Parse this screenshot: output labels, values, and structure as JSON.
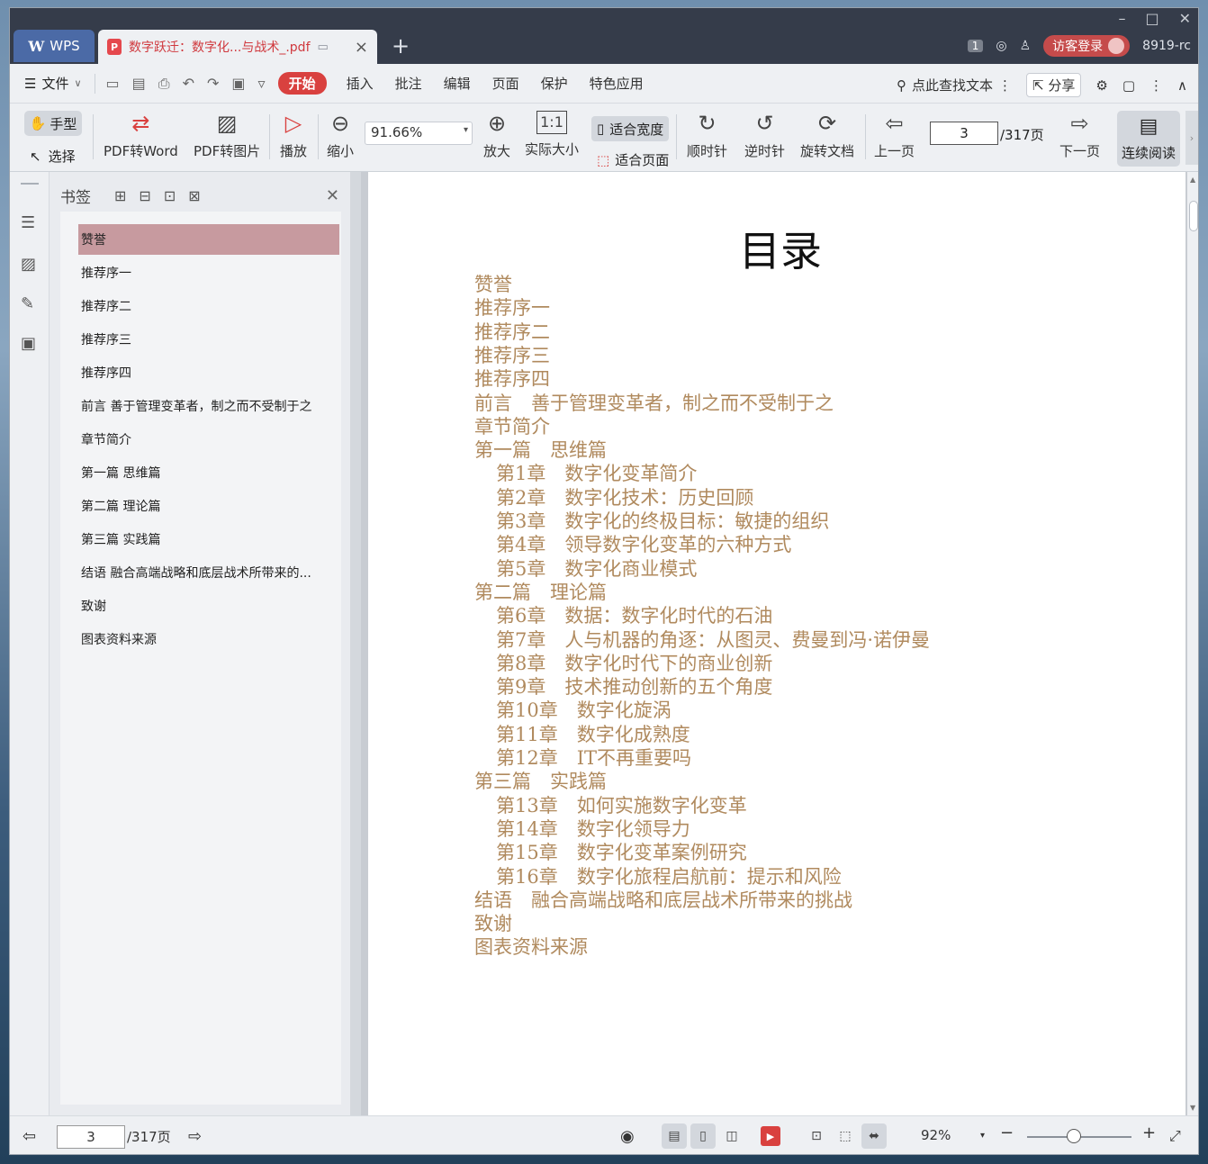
{
  "titlebar": {
    "wps_tab": "WPS",
    "doc_tab_title": "数字跃迁：数字化...与战术_.pdf",
    "page_badge": "1",
    "login_label": "访客登录",
    "user_id": "8919-rc"
  },
  "menu": {
    "file": "文件",
    "items": [
      "开始",
      "插入",
      "批注",
      "编辑",
      "页面",
      "保护",
      "特色应用"
    ],
    "search_label": "点此查找文本",
    "share_label": "分享"
  },
  "ribbon": {
    "hand": "手型",
    "select": "选择",
    "pdf_to_word": "PDF转Word",
    "pdf_to_image": "PDF转图片",
    "play": "播放",
    "zoom_out": "缩小",
    "zoom_value": "91.66%",
    "zoom_in": "放大",
    "actual_size": "实际大小",
    "fit_width": "适合宽度",
    "fit_page": "适合页面",
    "rotate_cw": "顺时针",
    "rotate_ccw": "逆时针",
    "rotate_doc": "旋转文档",
    "prev_page": "上一页",
    "current_page": "3",
    "total_pages": "/317页",
    "next_page": "下一页",
    "continuous": "连续阅读"
  },
  "bookmarks": {
    "title": "书签",
    "items": [
      {
        "label": "赞誉",
        "expandable": false,
        "selected": true
      },
      {
        "label": "推荐序一",
        "expandable": false
      },
      {
        "label": "推荐序二",
        "expandable": false
      },
      {
        "label": "推荐序三",
        "expandable": false
      },
      {
        "label": "推荐序四",
        "expandable": false
      },
      {
        "label": "前言 善于管理变革者，制之而不受制于之",
        "expandable": false
      },
      {
        "label": "章节简介",
        "expandable": false
      },
      {
        "label": "第一篇 思维篇",
        "expandable": true
      },
      {
        "label": "第二篇 理论篇",
        "expandable": true
      },
      {
        "label": "第三篇 实践篇",
        "expandable": true
      },
      {
        "label": "结语 融合高端战略和底层战术所带来的...",
        "expandable": false
      },
      {
        "label": "致谢",
        "expandable": false
      },
      {
        "label": "图表资料来源",
        "expandable": false
      }
    ]
  },
  "document": {
    "title": "目录",
    "toc": [
      {
        "text": "赞誉",
        "level": 0
      },
      {
        "text": "推荐序一",
        "level": 0
      },
      {
        "text": "推荐序二",
        "level": 0
      },
      {
        "text": "推荐序三",
        "level": 0
      },
      {
        "text": "推荐序四",
        "level": 0
      },
      {
        "text": "前言　善于管理变革者，制之而不受制于之",
        "level": 0
      },
      {
        "text": "章节简介",
        "level": 0
      },
      {
        "text": "第一篇　思维篇",
        "level": 0
      },
      {
        "text": "第1章　数字化变革简介",
        "level": 1
      },
      {
        "text": "第2章　数字化技术：历史回顾",
        "level": 1
      },
      {
        "text": "第3章　数字化的终极目标：敏捷的组织",
        "level": 1
      },
      {
        "text": "第4章　领导数字化变革的六种方式",
        "level": 1
      },
      {
        "text": "第5章　数字化商业模式",
        "level": 1
      },
      {
        "text": "第二篇　理论篇",
        "level": 0
      },
      {
        "text": "第6章　数据：数字化时代的石油",
        "level": 1
      },
      {
        "text": "第7章　人与机器的角逐：从图灵、费曼到冯·诺伊曼",
        "level": 1
      },
      {
        "text": "第8章　数字化时代下的商业创新",
        "level": 1
      },
      {
        "text": "第9章　技术推动创新的五个角度",
        "level": 1
      },
      {
        "text": "第10章　数字化旋涡",
        "level": 1
      },
      {
        "text": "第11章　数字化成熟度",
        "level": 1
      },
      {
        "text": "第12章　IT不再重要吗",
        "level": 1
      },
      {
        "text": "第三篇　实践篇",
        "level": 0
      },
      {
        "text": "第13章　如何实施数字化变革",
        "level": 1
      },
      {
        "text": "第14章　数字化领导力",
        "level": 1
      },
      {
        "text": "第15章　数字化变革案例研究",
        "level": 1
      },
      {
        "text": "第16章　数字化旅程启航前：提示和风险",
        "level": 1
      },
      {
        "text": "结语　融合高端战略和底层战术所带来的挑战",
        "level": 0
      },
      {
        "text": "致谢",
        "level": 0
      },
      {
        "text": "图表资料来源",
        "level": 0
      }
    ]
  },
  "statusbar": {
    "current_page": "3",
    "total_pages": "/317页",
    "zoom": "92%",
    "zoom_slider_fraction": 0.45
  },
  "colors": {
    "accent": "#d9413f",
    "toc_text": "#b08a5e",
    "bookmark_selected": "#c79a9f"
  }
}
